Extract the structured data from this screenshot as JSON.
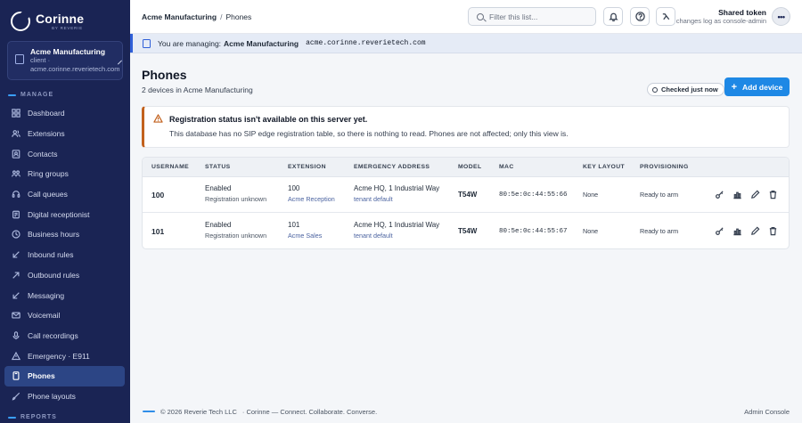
{
  "brand": {
    "name": "Corinne",
    "sub": "BY REVERIE"
  },
  "tenant_card": {
    "name": "Acme Manufacturing",
    "role": "client ·",
    "host": "acme.corinne.reverietech.com"
  },
  "sidebar": {
    "section_manage": "MANAGE",
    "section_reports": "REPORTS",
    "items": [
      {
        "label": "Dashboard",
        "icon": "dashboard-icon"
      },
      {
        "label": "Extensions",
        "icon": "users-icon"
      },
      {
        "label": "Contacts",
        "icon": "contact-card-icon"
      },
      {
        "label": "Ring groups",
        "icon": "group-icon"
      },
      {
        "label": "Call queues",
        "icon": "headset-icon"
      },
      {
        "label": "Digital receptionist",
        "icon": "receptionist-icon"
      },
      {
        "label": "Business hours",
        "icon": "clock-icon"
      },
      {
        "label": "Inbound rules",
        "icon": "arrow-down-left-icon"
      },
      {
        "label": "Outbound rules",
        "icon": "arrow-up-right-icon"
      },
      {
        "label": "Messaging",
        "icon": "message-arrow-icon"
      },
      {
        "label": "Voicemail",
        "icon": "mail-icon"
      },
      {
        "label": "Call recordings",
        "icon": "microphone-icon"
      },
      {
        "label": "Emergency · E911",
        "icon": "warning-icon"
      },
      {
        "label": "Phones",
        "icon": "phone-device-icon",
        "active": true
      },
      {
        "label": "Phone layouts",
        "icon": "brush-icon"
      }
    ]
  },
  "topbar": {
    "crumb_parent": "Acme Manufacturing",
    "crumb_sep": "/",
    "crumb_current": "Phones",
    "filter_placeholder": "Filter this list...",
    "token_title": "Shared token",
    "token_sub": "changes log as console-admin",
    "more_label": "•••"
  },
  "banner": {
    "prefix": "You are managing:",
    "tenant": "Acme Manufacturing",
    "host": "acme.corinne.reverietech.com"
  },
  "page": {
    "title": "Phones",
    "subtitle": "2 devices in Acme Manufacturing",
    "checked": "Checked just now",
    "add_button": "Add device",
    "add_plus": "+"
  },
  "alert": {
    "title": "Registration status isn't available on this server yet.",
    "body": "This database has no SIP edge registration table, so there is nothing to read. Phones are not affected; only this view is."
  },
  "table": {
    "columns": [
      "USERNAME",
      "STATUS",
      "EXTENSION",
      "EMERGENCY ADDRESS",
      "MODEL",
      "MAC",
      "KEY LAYOUT",
      "PROVISIONING"
    ],
    "rows": [
      {
        "username": "100",
        "status": "Enabled",
        "status_sub": "Registration unknown",
        "extension": "100",
        "extension_sub": "Acme Reception",
        "address": "Acme HQ, 1 Industrial Way",
        "address_sub": "tenant default",
        "model": "T54W",
        "mac": "80:5e:0c:44:55:66",
        "key_layout": "None",
        "provisioning": "Ready to arm"
      },
      {
        "username": "101",
        "status": "Enabled",
        "status_sub": "Registration unknown",
        "extension": "101",
        "extension_sub": "Acme Sales",
        "address": "Acme HQ, 1 Industrial Way",
        "address_sub": "tenant default",
        "model": "T54W",
        "mac": "80:5e:0c:44:55:67",
        "key_layout": "None",
        "provisioning": "Ready to arm"
      }
    ]
  },
  "footer": {
    "copyright": "© 2026 Reverie Tech LLC",
    "tagline": "· Corinne — Connect. Collaborate. Converse.",
    "right": "Admin Console"
  },
  "colors": {
    "sidebar_bg": "#1a2454",
    "accent": "#1e88e5",
    "active_item": "#2c4585",
    "alert_border": "#c2611d"
  }
}
